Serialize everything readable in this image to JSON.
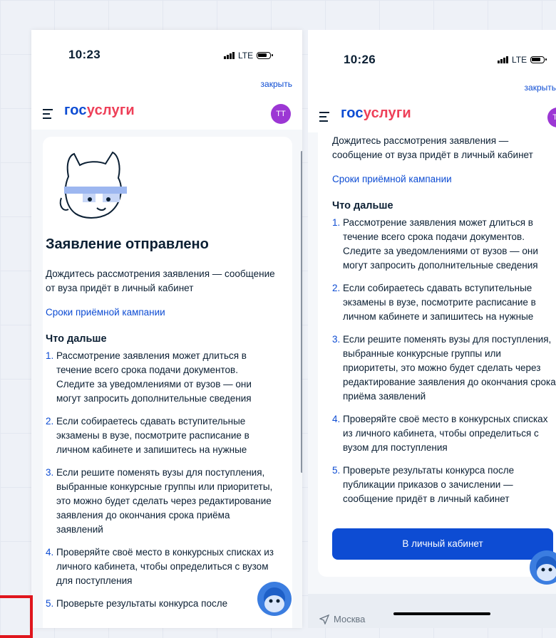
{
  "colors": {
    "accent": "#0d4cd3",
    "logo_red": "#ee3f58",
    "avatar": "#9c37d4",
    "button": "#0d4cd3"
  },
  "left": {
    "time": "10:23",
    "network": "LTE",
    "close": "закрыть",
    "logo_a": "гос",
    "logo_b": "услуги",
    "avatar": "ТТ",
    "title": "Заявление отправлено",
    "message": "Дождитесь рассмотрения заявления — сообщение от вуза придёт в личный кабинет",
    "link": "Сроки приёмной кампании",
    "subhead": "Что дальше",
    "steps": [
      {
        "num": "1.",
        "text": "Рассмотрение заявления может длиться в течение всего срока подачи документов. Следите за уведомлениями от вузов — они могут запросить дополнительные сведения"
      },
      {
        "num": "2.",
        "text": "Если собираетесь сдавать вступительные экзамены в вузе, посмотрите расписание в личном кабинете и запишитесь на нужные"
      },
      {
        "num": "3.",
        "text": "Если решите поменять вузы для поступления, выбранные конкурсные группы или приоритеты, это можно будет сделать через редактирование заявления до окончания срока приёма заявлений"
      },
      {
        "num": "4.",
        "text": "Проверяйте своё место в конкурсных списках из личного кабинета, чтобы определиться с вузом для поступления"
      },
      {
        "num": "5.",
        "text": "Проверьте результаты конкурса после"
      }
    ]
  },
  "right": {
    "time": "10:26",
    "network": "LTE",
    "close": "закрыть",
    "logo_a": "гос",
    "logo_b": "услуги",
    "avatar": "ТТ",
    "message": "Дождитесь рассмотрения заявления — сообщение от вуза придёт в личный кабинет",
    "link": "Сроки приёмной кампании",
    "subhead": "Что дальше",
    "steps": [
      {
        "num": "1.",
        "text": "Рассмотрение заявления может длиться в течение всего срока подачи документов. Следите за уведомлениями от вузов — они могут запросить дополнительные сведения"
      },
      {
        "num": "2.",
        "text": "Если собираетесь сдавать вступительные экзамены в вузе, посмотрите расписание в личном кабинете и запишитесь на нужные"
      },
      {
        "num": "3.",
        "text": "Если решите поменять вузы для поступления, выбранные конкурсные группы или приоритеты, это можно будет сделать через редактирование заявления до окончания срока приёма заявлений"
      },
      {
        "num": "4.",
        "text": "Проверяйте своё место в конкурсных списках из личного кабинета, чтобы определиться с вузом для поступления"
      },
      {
        "num": "5.",
        "text": "Проверьте результаты конкурса после публикации приказов о зачислении — сообщение придёт в личный кабинет"
      }
    ],
    "button": "В личный кабинет",
    "location": "Москва"
  }
}
